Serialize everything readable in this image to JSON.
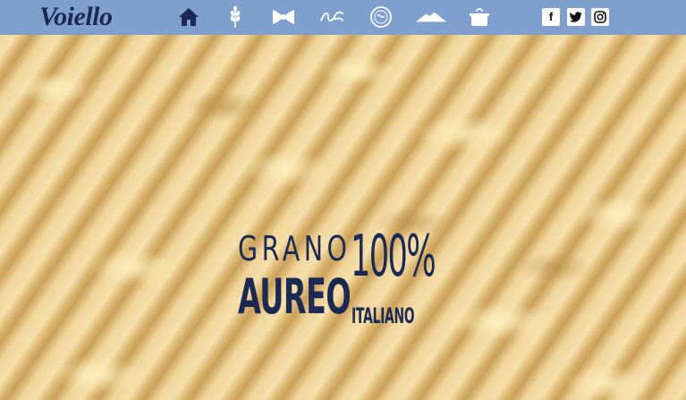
{
  "brand": {
    "logo_text": "Voiello"
  },
  "nav": {
    "items": [
      {
        "icon": "home-icon"
      },
      {
        "icon": "wheat-icon"
      },
      {
        "icon": "farfalle-pasta-icon"
      },
      {
        "icon": "signature-icon"
      },
      {
        "icon": "seal-icon"
      },
      {
        "icon": "mountain-icon"
      },
      {
        "icon": "pot-icon"
      }
    ],
    "social": [
      {
        "icon": "facebook-icon",
        "glyph": "f"
      },
      {
        "icon": "twitter-icon",
        "glyph": "t"
      },
      {
        "icon": "instagram-icon",
        "glyph": "ig"
      }
    ]
  },
  "hero": {
    "line1_left": "GRANO",
    "line2_left": "AUREO",
    "line1_right": "100%",
    "line2_right": "ITALIANO"
  },
  "colors": {
    "navbar": "#7f9fcf",
    "navy": "#1b2a55",
    "pasta": "#e8c88a"
  }
}
